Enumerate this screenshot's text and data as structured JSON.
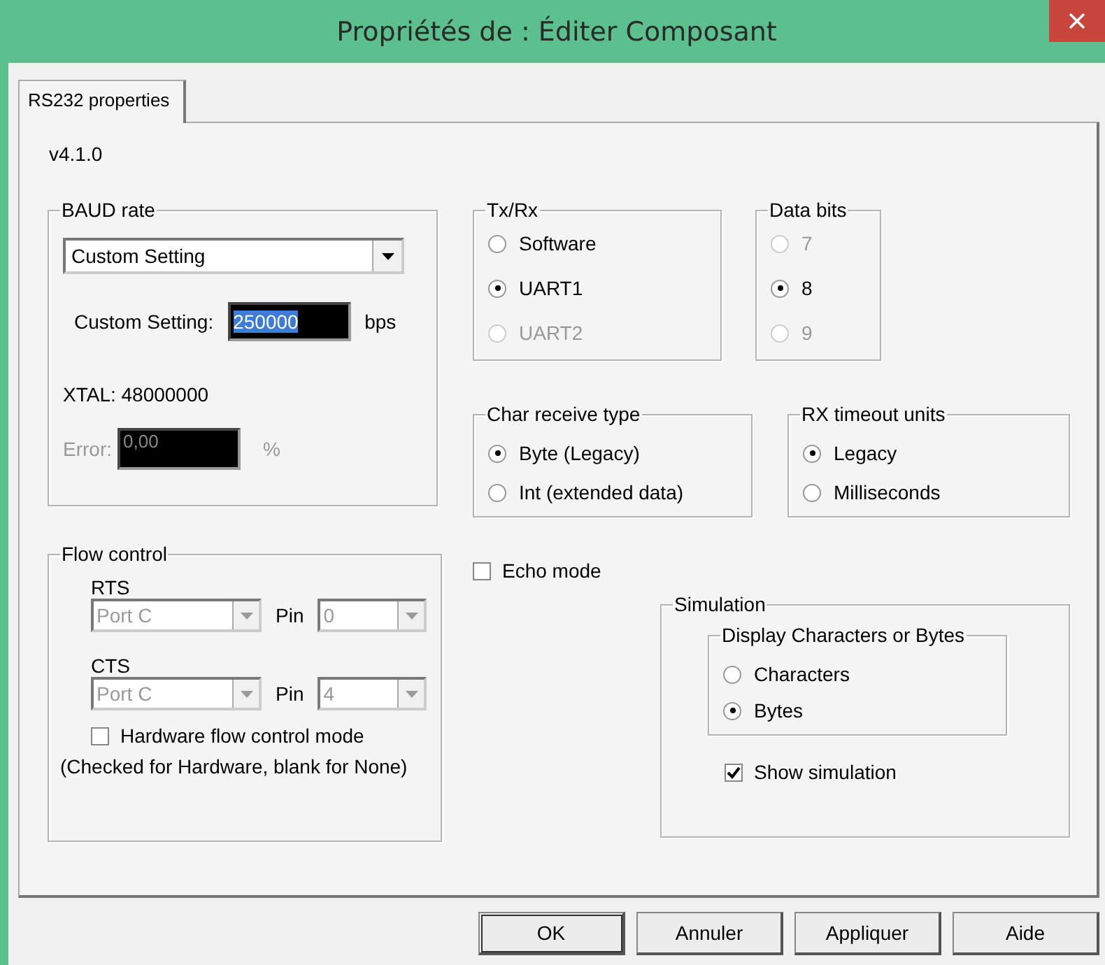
{
  "window": {
    "title": "Propriétés de : Éditer Composant"
  },
  "tabs": [
    {
      "label": "RS232 properties",
      "selected": true
    }
  ],
  "version": "v4.1.0",
  "baud_rate": {
    "label": "BAUD rate",
    "dropdown": "Custom Setting",
    "custom_label": "Custom Setting:",
    "custom_value": "250000",
    "custom_unit": "bps",
    "xtal": "XTAL: 48000000",
    "error_label": "Error:",
    "error_value": "0,00",
    "error_unit": "%",
    "error_disabled": true
  },
  "tx_rx": {
    "label": "Tx/Rx",
    "options": [
      {
        "label": "Software",
        "selected": false,
        "disabled": false
      },
      {
        "label": "UART1",
        "selected": true,
        "disabled": false
      },
      {
        "label": "UART2",
        "selected": false,
        "disabled": true
      }
    ]
  },
  "data_bits": {
    "label": "Data bits",
    "options": [
      {
        "label": "7",
        "selected": false,
        "disabled": true
      },
      {
        "label": "8",
        "selected": true,
        "disabled": false
      },
      {
        "label": "9",
        "selected": false,
        "disabled": true
      }
    ]
  },
  "char_receive_type": {
    "label": "Char receive type",
    "options": [
      {
        "label": "Byte (Legacy)",
        "selected": true,
        "disabled": false
      },
      {
        "label": "Int (extended data)",
        "selected": false,
        "disabled": false
      }
    ]
  },
  "rx_timeout_units": {
    "label": "RX timeout units",
    "options": [
      {
        "label": "Legacy",
        "selected": true,
        "disabled": false
      },
      {
        "label": "Milliseconds",
        "selected": false,
        "disabled": false
      }
    ]
  },
  "flow_control": {
    "label": "Flow control",
    "lines": [
      {
        "label": "RTS",
        "port": "Port C",
        "pin_label": "Pin",
        "pin": "0",
        "disabled": true
      },
      {
        "label": "CTS",
        "port": "Port C",
        "pin_label": "Pin",
        "pin": "4",
        "disabled": true
      }
    ],
    "hardware_mode": {
      "label": "Hardware flow control mode",
      "checked": false
    },
    "note": "(Checked for Hardware, blank for None)"
  },
  "echo_mode": {
    "label": "Echo mode",
    "checked": false
  },
  "simulation": {
    "label": "Simulation",
    "display": {
      "label": "Display Characters or Bytes",
      "options": [
        {
          "label": "Characters",
          "selected": false,
          "disabled": false
        },
        {
          "label": "Bytes",
          "selected": true,
          "disabled": false
        }
      ]
    },
    "show_simulation": {
      "label": "Show simulation",
      "checked": true
    }
  },
  "buttons": [
    {
      "label": "OK",
      "default": true
    },
    {
      "label": "Annuler",
      "default": false
    },
    {
      "label": "Appliquer",
      "default": false
    },
    {
      "label": "Aide",
      "default": false
    }
  ]
}
